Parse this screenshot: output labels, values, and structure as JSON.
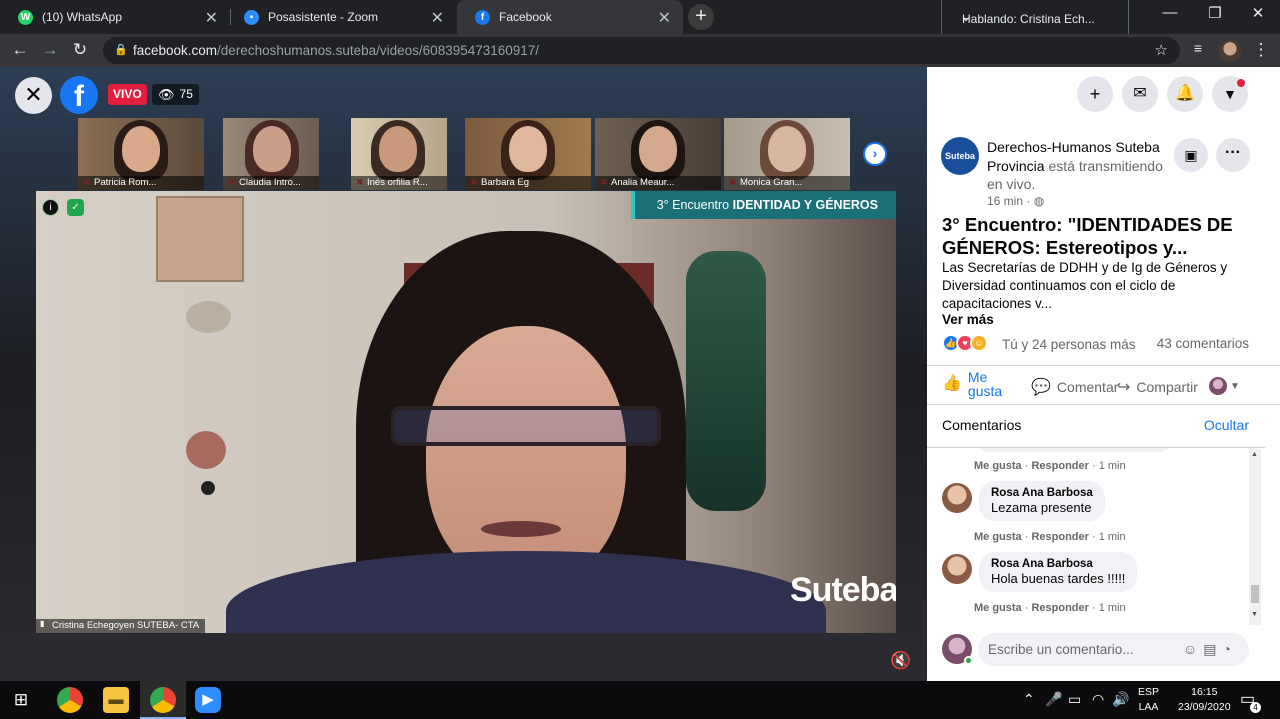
{
  "browser": {
    "tabs": [
      {
        "title": "(10) WhatsApp",
        "icon": "whatsapp-icon",
        "color": "#25d366",
        "glyph": "W"
      },
      {
        "title": "Posasistente - Zoom",
        "icon": "zoom-icon",
        "color": "#2d8cff",
        "glyph": "Z"
      },
      {
        "title": "Facebook",
        "icon": "facebook-icon",
        "color": "#1877f2",
        "glyph": "f"
      }
    ],
    "close_glyph": "✕",
    "new_tab_glyph": "+",
    "speaking_indicator": "Hablando: Cristina Ech...",
    "url_host": "facebook.com",
    "url_path": "/derechoshumanos.suteba/videos/608395473160917/"
  },
  "video": {
    "live_label": "VIVO",
    "viewer_count": "75",
    "event_banner_prefix": "3° Encuentro ",
    "event_banner_bold": "IDENTIDAD Y GÉNEROS",
    "speaker_name": "Cristina Echegoyen SUTEBA- CTA",
    "watermark": "Suteba",
    "participants": [
      {
        "name": "Patricia Rom...",
        "bg": "#8a6f55",
        "hair": "#2a1b17",
        "skin": "#d9a98c"
      },
      {
        "name": "Claudia Intro...",
        "bg": "#9c8a7a",
        "hair": "#4a2b24",
        "skin": "#c9a087"
      },
      {
        "name": "Inés orfilia R...",
        "bg": "#b7a58a",
        "hair": "#3a2a22",
        "skin": "#c89a7b"
      },
      {
        "name": "Barbara Eg",
        "bg": "#7b5a3e",
        "hair": "#3b2216",
        "skin": "#e0b99d"
      },
      {
        "name": "Analia Meaur...",
        "bg": "#6f5f52",
        "hair": "#1e1512",
        "skin": "#d5a98e"
      },
      {
        "name": "Monica Gran...",
        "bg": "#a59a8c",
        "hair": "#6b4a3a",
        "skin": "#d8b6a0"
      }
    ]
  },
  "post": {
    "page_avatar_label": "Suteba",
    "page_name": "Derechos-Humanos Suteba Provincia",
    "status_text": " está transmitiendo en vivo.",
    "time": "16 min · ",
    "title": "3° Encuentro: \"IDENTIDADES DE GÉNEROS: Estereotipos y...",
    "description": "Las Secretarías de DDHH y de Ig de Géneros y Diversidad continuamos con el ciclo de capacitaciones v...",
    "see_more": "Ver más",
    "reaction_text": "Tú y 24 personas más",
    "comment_count": "43 comentarios",
    "like_label": "Me gusta",
    "comment_label": "Comentar",
    "share_label": "Compartir",
    "comments_header": "Comentarios",
    "hide_label": "Ocultar",
    "comments": [
      {
        "author": "Rosa Ana Barbosa",
        "text": "Lezama presente",
        "like": "Me gusta",
        "reply": "Responder",
        "time": "1 min"
      },
      {
        "author": "Rosa Ana Barbosa",
        "text": "Hola buenas tardes !!!!!",
        "like": "Me gusta",
        "reply": "Responder",
        "time": "1 min"
      }
    ],
    "prev_comment_meta": {
      "like": "Me gusta",
      "reply": "Responder",
      "time": "1 min"
    },
    "composer_placeholder": "Escribe un comentario..."
  },
  "taskbar": {
    "language": "ESP",
    "layout": "LAA",
    "time": "16:15",
    "date": "23/09/2020",
    "notification_count": "4"
  }
}
